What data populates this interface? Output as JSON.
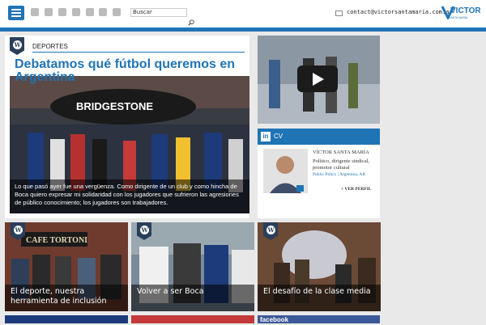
{
  "header": {
    "search_placeholder": "Buscar",
    "contact_email": "contact@victorsantamaria.com.ar",
    "logo_text": "VICTOR",
    "logo_sub": "SANTA MARÍA",
    "social_icons": [
      "twitter-icon",
      "flickr-icon",
      "blogger-icon",
      "share-icon",
      "google-icon",
      "soundcloud-icon",
      "youtube-icon"
    ],
    "accent_color": "#1f74b5"
  },
  "feature": {
    "section": "DEPORTES",
    "title": "Debatamos qué fútbol queremos en Argentina",
    "caption": "Lo que pasó ayer fue una vergüenza. Como dirigente de un club y como hincha de Boca quiero expresar mi solidaridad con los jugadores que sufrieron las agresiones de público conocimiento; los jugadores son trabajadores.",
    "sign_text": "BRIDGESTONE"
  },
  "cv": {
    "title": "CV",
    "name": "VÍCTOR SANTA MARÍA",
    "description": "Político, dirigente sindical, promotor cultural",
    "location": "Public Policy | Argentina, AR",
    "more": "+ VER PERFIL"
  },
  "tiles": [
    {
      "caption": "El deporte, nuestra herramienta de inclusión",
      "sign": "CAFE TORTONI"
    },
    {
      "caption": "Volver a ser Boca"
    },
    {
      "caption": "El desafío de la clase media"
    }
  ],
  "facebook_label": "facebook"
}
